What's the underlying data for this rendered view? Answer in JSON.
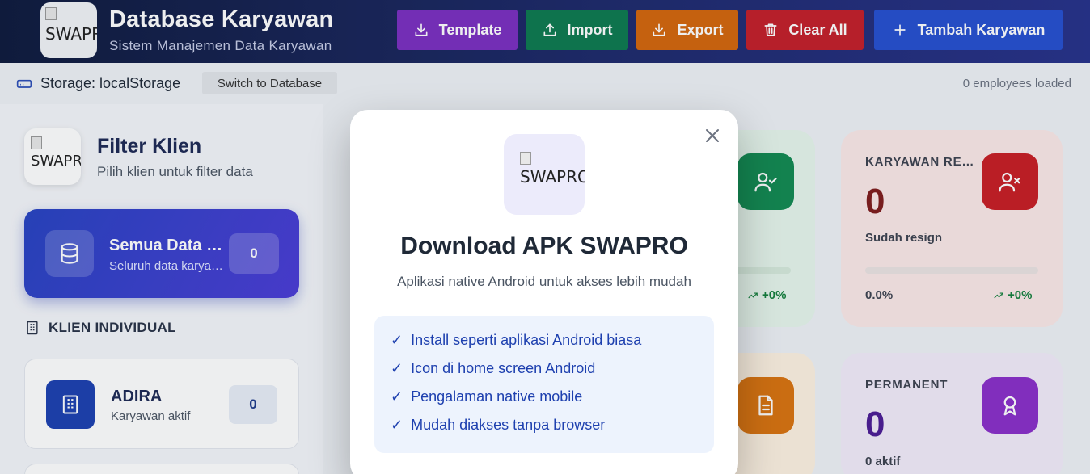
{
  "header": {
    "logo_alt": "SWAPRO",
    "title": "Database Karyawan",
    "subtitle": "Sistem Manajemen Data Karyawan",
    "buttons": {
      "template": "Template",
      "import": "Import",
      "export": "Export",
      "clear_all": "Clear All",
      "add": "Tambah Karyawan"
    }
  },
  "storage": {
    "label": "Storage: localStorage",
    "switch_label": "Switch to Database",
    "loaded": "0 employees loaded"
  },
  "sidebar": {
    "logo_alt": "SWAPRO",
    "title": "Filter Klien",
    "subtitle": "Pilih klien untuk filter data",
    "all": {
      "title": "Semua Data Klien",
      "subtitle": "Seluruh data karyawan",
      "count": "0"
    },
    "section_label": "KLIEN INDIVIDUAL",
    "clients": [
      {
        "name": "ADIRA",
        "subtitle": "Karyawan aktif",
        "count": "0"
      }
    ]
  },
  "stats": {
    "active": {
      "pct_trend": "+0%"
    },
    "resign": {
      "label": "KARYAWAN RESIGN",
      "value": "0",
      "desc": "Sudah resign",
      "pct": "0.0%",
      "trend": "+0%"
    },
    "permanent": {
      "label": "PERMANENT",
      "value": "0",
      "desc": "0 aktif"
    }
  },
  "modal": {
    "logo_alt": "SWAPRO",
    "title": "Download APK SWAPRO",
    "subtitle": "Aplikasi native Android untuk akses lebih mudah",
    "features": [
      "Install seperti aplikasi Android biasa",
      "Icon di home screen Android",
      "Pengalaman native mobile",
      "Mudah diakses tanpa browser"
    ],
    "check": "✓"
  },
  "colors": {
    "header_dark": "#0f1b3d",
    "template": "#7b2fc1",
    "import": "#0e7a50",
    "export": "#d4660d",
    "clear": "#c41f2a",
    "add": "#2650d0",
    "resign_value": "#7f1d1d",
    "permanent_value": "#4c1d95"
  }
}
